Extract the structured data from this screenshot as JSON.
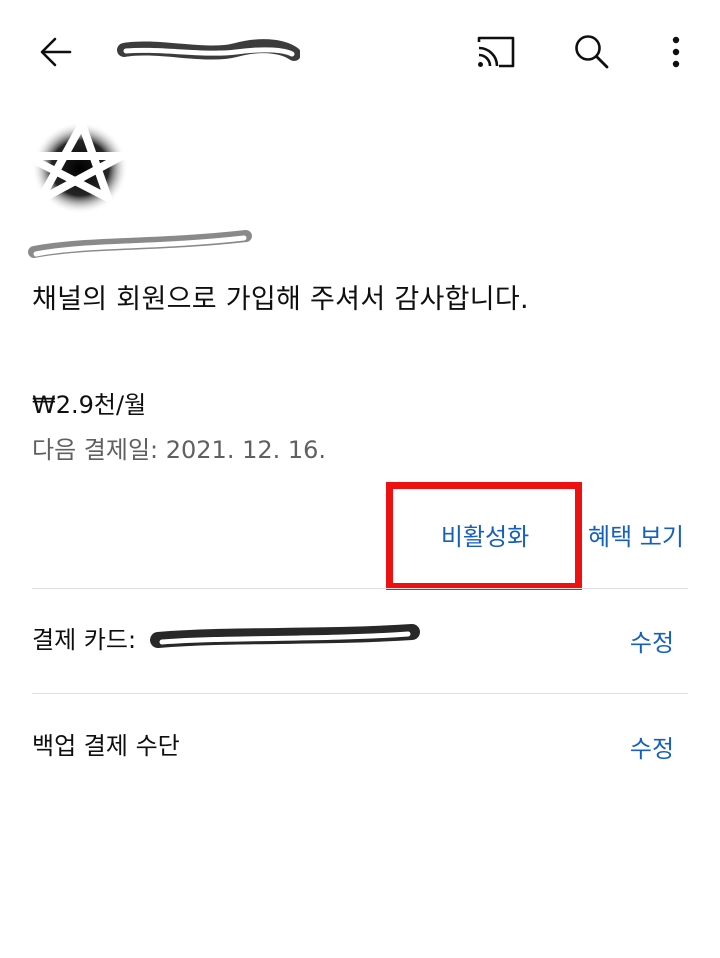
{
  "header": {
    "back_icon": "arrow-left-icon",
    "cast_icon": "cast-icon",
    "search_icon": "search-icon",
    "more_icon": "more-vertical-icon"
  },
  "membership": {
    "thanks_message": "채널의 회원으로 가입해 주셔서 감사합니다.",
    "price": "₩2.9천/월",
    "next_billing": "다음 결제일: 2021. 12. 16.",
    "deactivate_label": "비활성화",
    "benefits_label": "혜택 보기"
  },
  "payment": {
    "card_label": "결제 카드:",
    "card_edit_label": "수정",
    "backup_label": "백업 결제 수단",
    "backup_edit_label": "수정"
  },
  "colors": {
    "link": "#1560bd",
    "highlight": "#ee1111",
    "secondary_text": "#606060"
  }
}
